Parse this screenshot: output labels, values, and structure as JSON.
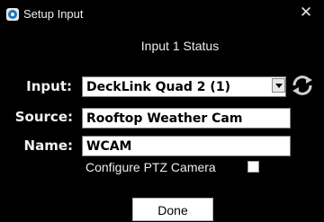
{
  "window": {
    "title": "Setup Input",
    "close_glyph": "✕"
  },
  "status": {
    "text": "Input 1 Status"
  },
  "input_row": {
    "label": "Input:",
    "selected_value": "DeckLink Quad 2 (1)",
    "dropdown_icon": "chevron-down-icon",
    "refresh_icon": "refresh-icon"
  },
  "source_row": {
    "label": "Source:",
    "value": "Rooftop Weather Cam"
  },
  "name_row": {
    "label": "Name:",
    "value": "WCAM"
  },
  "ptz": {
    "label": "Configure PTZ Camera",
    "checked": false
  },
  "actions": {
    "done_label": "Done"
  },
  "colors": {
    "background": "#000000",
    "text": "#f2f2f2",
    "field_bg": "#ffffff"
  }
}
